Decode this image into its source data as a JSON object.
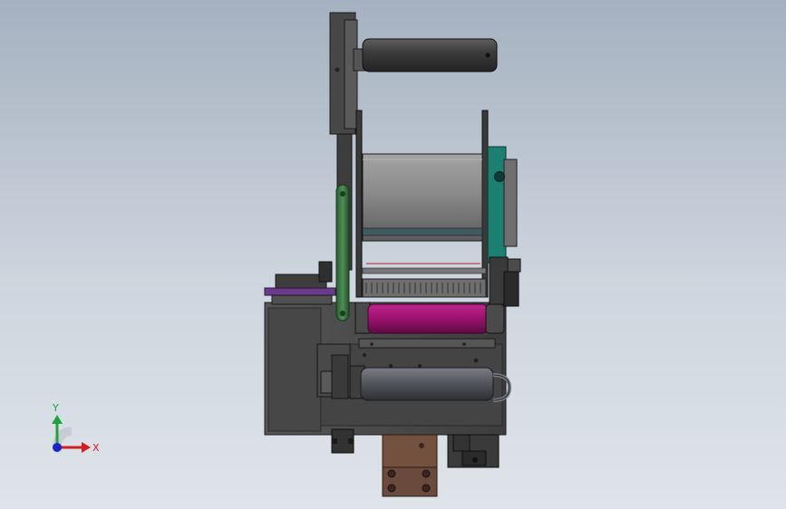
{
  "view": {
    "background_top": "#a5b1c0",
    "background_bottom": "#dfe4ea"
  },
  "triad": {
    "y_label": "Y",
    "x_label": "X",
    "y_color": "#1fa33a",
    "x_color": "#d21e1e",
    "z_color": "#1a22c8"
  },
  "colors": {
    "body": "#4a4a4a",
    "body_dark": "#2f2f2f",
    "drum": "#8d8d8d",
    "roller_magenta": "#9e1270",
    "teal_ring": "#1d7e72",
    "green_rod": "#2f6a35",
    "cylinder": "#55575d",
    "brown_block": "#6b4a3e",
    "purple_plate": "#6a3b8a"
  }
}
